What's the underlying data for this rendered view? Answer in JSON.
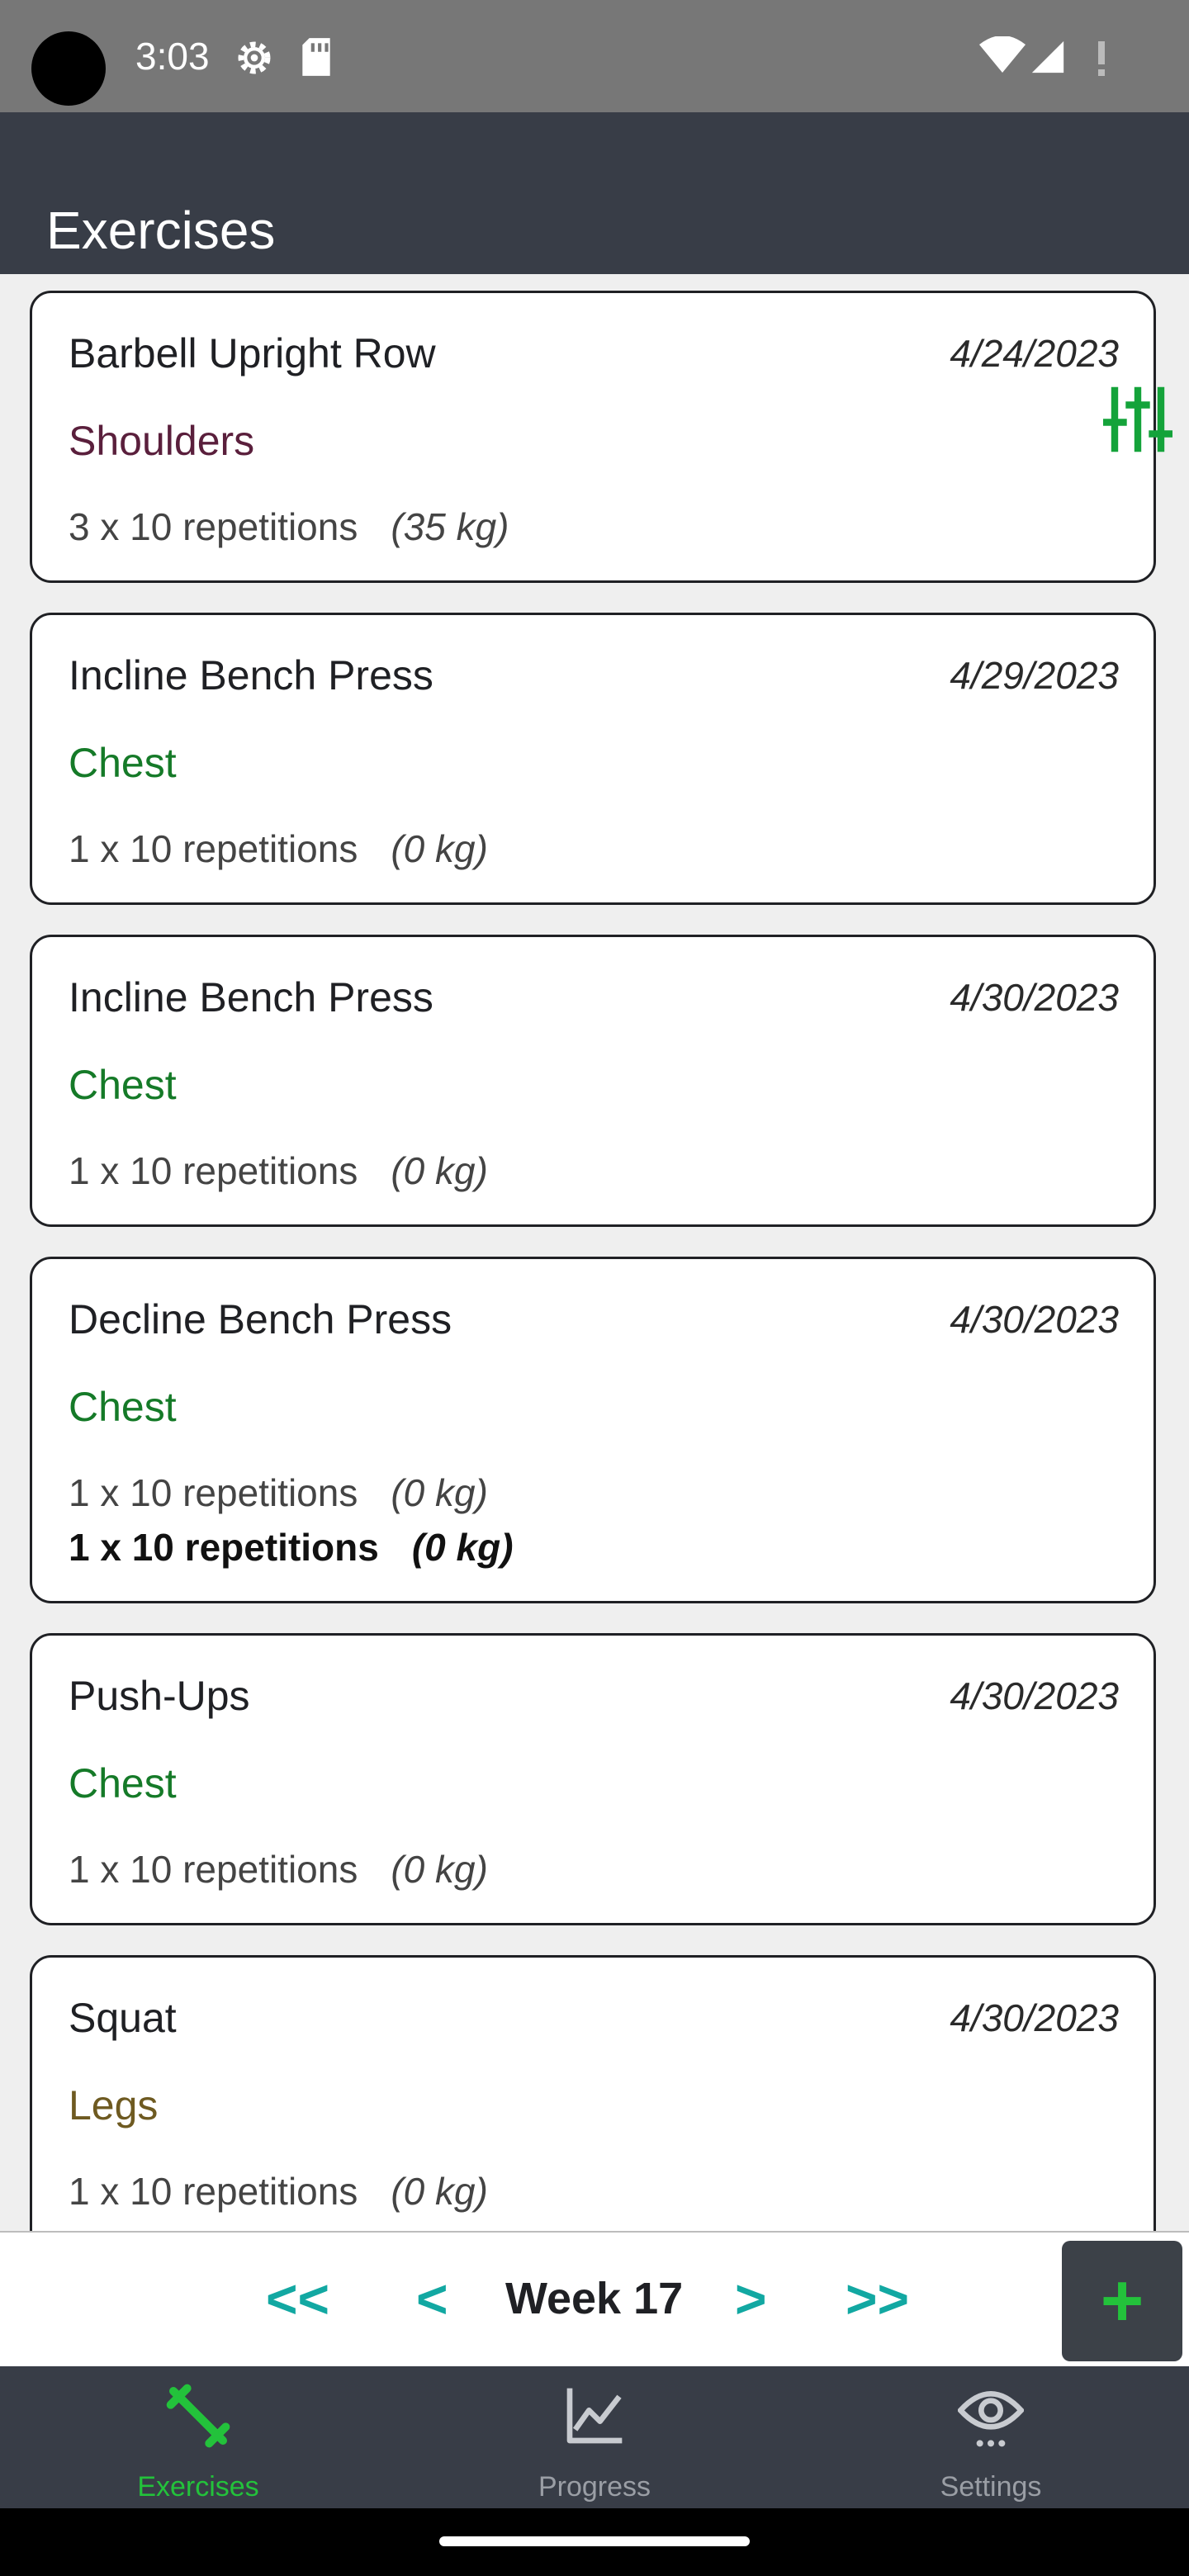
{
  "status_bar": {
    "time": "3:03",
    "icons": [
      "settings-gear-icon",
      "sd-card-icon",
      "wifi-icon",
      "cell-signal-icon",
      "alert-icon"
    ]
  },
  "app_bar": {
    "title": "Exercises"
  },
  "colors": {
    "app_bar": "#383d47",
    "chest": "#157a28",
    "shoulders": "#5a1f3c",
    "legs": "#6e5a21",
    "accent_teal": "#12a8a2",
    "active_nav": "#23c23b",
    "inactive_nav": "#9a9ea5"
  },
  "filter_button": {
    "icon": "sliders-icon"
  },
  "exercises": [
    {
      "name": "Barbell Upright Row",
      "date": "4/24/2023",
      "group": "Shoulders",
      "sets": [
        {
          "reps": "3 x 10 repetitions",
          "weight": "(35 kg)"
        }
      ]
    },
    {
      "name": "Incline Bench Press",
      "date": "4/29/2023",
      "group": "Chest",
      "sets": [
        {
          "reps": "1 x 10 repetitions",
          "weight": "(0 kg)"
        }
      ]
    },
    {
      "name": "Incline Bench Press",
      "date": "4/30/2023",
      "group": "Chest",
      "sets": [
        {
          "reps": "1 x 10 repetitions",
          "weight": "(0 kg)"
        }
      ]
    },
    {
      "name": "Decline Bench Press",
      "date": "4/30/2023",
      "group": "Chest",
      "sets": [
        {
          "reps": "1 x 10 repetitions",
          "weight": "(0 kg)"
        },
        {
          "reps": "1 x 10 repetitions",
          "weight": "(0 kg)"
        }
      ]
    },
    {
      "name": "Push-Ups",
      "date": "4/30/2023",
      "group": "Chest",
      "sets": [
        {
          "reps": "1 x 10 repetitions",
          "weight": "(0 kg)"
        }
      ]
    },
    {
      "name": "Squat",
      "date": "4/30/2023",
      "group": "Legs",
      "sets": [
        {
          "reps": "1 x 10 repetitions",
          "weight": "(0 kg)"
        }
      ]
    }
  ],
  "week_nav": {
    "first": "<<",
    "prev": "<",
    "label": "Week 17",
    "next": ">",
    "last": ">>",
    "add": "+"
  },
  "bottom_nav": {
    "items": [
      {
        "label": "Exercises",
        "icon": "dumbbell-icon",
        "active": true
      },
      {
        "label": "Progress",
        "icon": "line-chart-icon",
        "active": false
      },
      {
        "label": "Settings",
        "icon": "eye-icon",
        "active": false
      }
    ]
  }
}
